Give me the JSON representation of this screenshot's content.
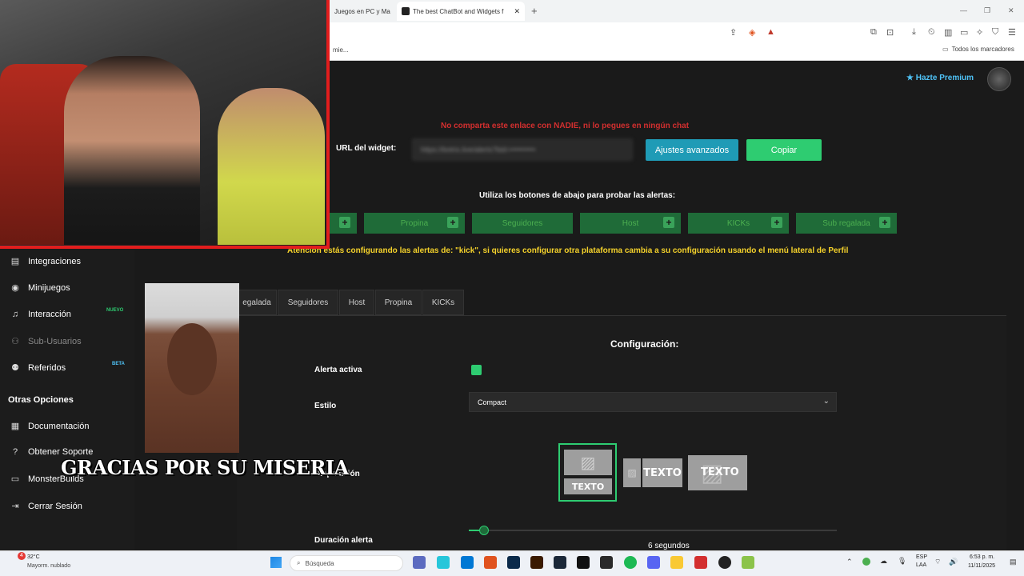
{
  "browser": {
    "tabs": [
      {
        "label": "Juegos en PC y Ma"
      },
      {
        "label": "The best ChatBot and Widgets f"
      }
    ],
    "new_tab": "+",
    "close_tab": "✕",
    "bookmarks_partial": "mie...",
    "bookmarks_folder": "Todos los marcadores"
  },
  "header": {
    "premium_label": "Hazte Premium"
  },
  "widget": {
    "warning": "No comparta este enlace con NADIE, ni lo pegues en ningún chat",
    "url_label": "URL del widget:",
    "url_value": "https://botrix.live/alerts?bid=••••••••••",
    "advanced_button": "Ajustes avanzados",
    "copy_button": "Copiar",
    "test_title": "Utiliza los botones de abajo para probar las alertas:",
    "test_buttons": [
      {
        "label": ""
      },
      {
        "label": "Propina"
      },
      {
        "label": "Seguidores"
      },
      {
        "label": "Host"
      },
      {
        "label": "KICKs"
      },
      {
        "label": "Sub regalada"
      }
    ],
    "plus": "+",
    "attention": "Atención estás configurando las alertas de: \"kick\", si quieres configurar otra plataforma cambia a su configuración usando el menú lateral de Perfil"
  },
  "alert_tabs": [
    {
      "label": "egalada"
    },
    {
      "label": "Seguidores"
    },
    {
      "label": "Host"
    },
    {
      "label": "Propina"
    },
    {
      "label": "KICKs"
    }
  ],
  "config": {
    "title": "Configuración:",
    "alert_active_label": "Alerta activa",
    "style_label": "Estilo",
    "style_value": "Compact",
    "layout_label": "Disposición",
    "layout_texto": "TEXTO",
    "duration_label": "Duración alerta",
    "duration_value": 6,
    "duration_text": "6 segundos"
  },
  "sidebar": {
    "items": [
      {
        "label": "Integraciones",
        "icon": "integrations-icon"
      },
      {
        "label": "Minijuegos",
        "icon": "gamepad-icon"
      },
      {
        "label": "Interacción",
        "icon": "music-icon",
        "badge": "NUEVO"
      },
      {
        "label": "Sub-Usuarios",
        "icon": "users-icon"
      },
      {
        "label": "Referidos",
        "icon": "referrals-icon",
        "badge": "BETA"
      }
    ],
    "section_title": "Otras Opciones",
    "other_items": [
      {
        "label": "Documentación",
        "icon": "book-icon"
      },
      {
        "label": "Obtener Soporte",
        "icon": "help-icon"
      },
      {
        "label": "MonsterBuilds",
        "icon": "monitor-icon"
      },
      {
        "label": "Cerrar Sesión",
        "icon": "logout-icon"
      }
    ]
  },
  "overlay": {
    "subtitle": "GRACIAS POR SU MISERIA"
  },
  "taskbar": {
    "weather_temp": "32°C",
    "weather_desc": "Mayorm. nublado",
    "weather_alert": "4",
    "search_placeholder": "Búsqueda",
    "lang_top": "ESP",
    "lang_bottom": "LAA",
    "time": "6:53 p. m.",
    "date": "11/11/2025"
  },
  "colors": {
    "accent_green": "#2ecc71",
    "accent_teal": "#1f9bb6",
    "warning_red": "#d32f2f",
    "attention_yellow": "#f5d22b",
    "premium_blue": "#4fc3f7",
    "webcam_border": "#e21d1d"
  }
}
